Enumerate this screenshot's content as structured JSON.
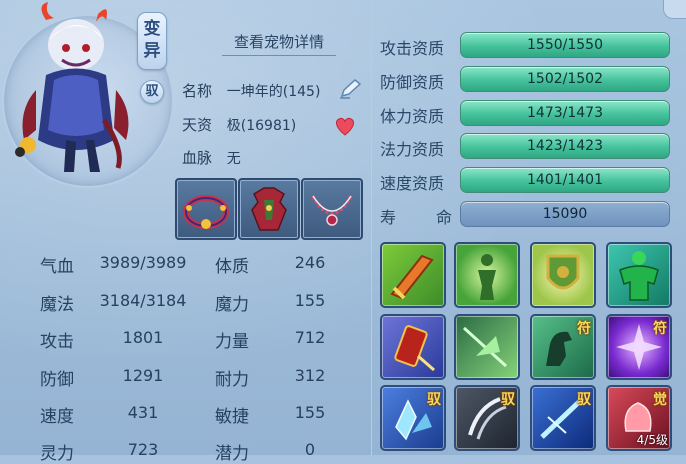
{
  "pet": {
    "badge_variant": "变异",
    "badge_tame": "驭",
    "detail_link": "查看宠物详情",
    "name_label": "名称",
    "name_value": "一坤年的(145)",
    "talent_label": "天资",
    "talent_value": "极(16981)",
    "bloodline_label": "血脉",
    "bloodline_value": "无"
  },
  "equipment": [
    {
      "name": "collar-icon"
    },
    {
      "name": "armor-icon"
    },
    {
      "name": "necklace-icon"
    }
  ],
  "stats": [
    {
      "label": "气血",
      "value": "3989/3989",
      "label2": "体质",
      "value2": "246"
    },
    {
      "label": "魔法",
      "value": "3184/3184",
      "label2": "魔力",
      "value2": "155"
    },
    {
      "label": "攻击",
      "value": "1801",
      "label2": "力量",
      "value2": "712"
    },
    {
      "label": "防御",
      "value": "1291",
      "label2": "耐力",
      "value2": "312"
    },
    {
      "label": "速度",
      "value": "431",
      "label2": "敏捷",
      "value2": "155"
    },
    {
      "label": "灵力",
      "value": "723",
      "label2": "潜力",
      "value2": "0"
    }
  ],
  "aptitudes": [
    {
      "label": "攻击资质",
      "value": "1550/1550",
      "fill": 1.0
    },
    {
      "label": "防御资质",
      "value": "1502/1502",
      "fill": 1.0
    },
    {
      "label": "体力资质",
      "value": "1473/1473",
      "fill": 1.0
    },
    {
      "label": "法力资质",
      "value": "1423/1423",
      "fill": 1.0
    },
    {
      "label": "速度资质",
      "value": "1401/1401",
      "fill": 1.0
    }
  ],
  "lifespan": {
    "label_a": "寿",
    "label_b": "命",
    "value": "15090"
  },
  "skills": [
    {
      "name": "sword-skill-icon",
      "tag": "",
      "level": ""
    },
    {
      "name": "figure-skill-icon",
      "tag": "",
      "level": ""
    },
    {
      "name": "shield-skill-icon",
      "tag": "",
      "level": ""
    },
    {
      "name": "muscle-skill-icon",
      "tag": "",
      "level": ""
    },
    {
      "name": "scroll-skill-icon",
      "tag": "",
      "level": ""
    },
    {
      "name": "shard-skill-icon",
      "tag": "",
      "level": ""
    },
    {
      "name": "horse-skill-icon",
      "tag": "符",
      "level": ""
    },
    {
      "name": "purple-burst-skill-icon",
      "tag": "符",
      "level": ""
    },
    {
      "name": "crystal-skill-icon",
      "tag": "驭",
      "level": ""
    },
    {
      "name": "claw-skill-icon",
      "tag": "驭",
      "level": ""
    },
    {
      "name": "blade-skill-icon",
      "tag": "驭",
      "level": ""
    },
    {
      "name": "awaken-skill-icon",
      "tag": "觉",
      "level": "4/5级"
    }
  ],
  "colors": {
    "bar_fill": "#45c29b",
    "life_bar": "#6f93bd",
    "panel_bg": "#99b8d6",
    "tag_gold": "#f6d85a"
  }
}
